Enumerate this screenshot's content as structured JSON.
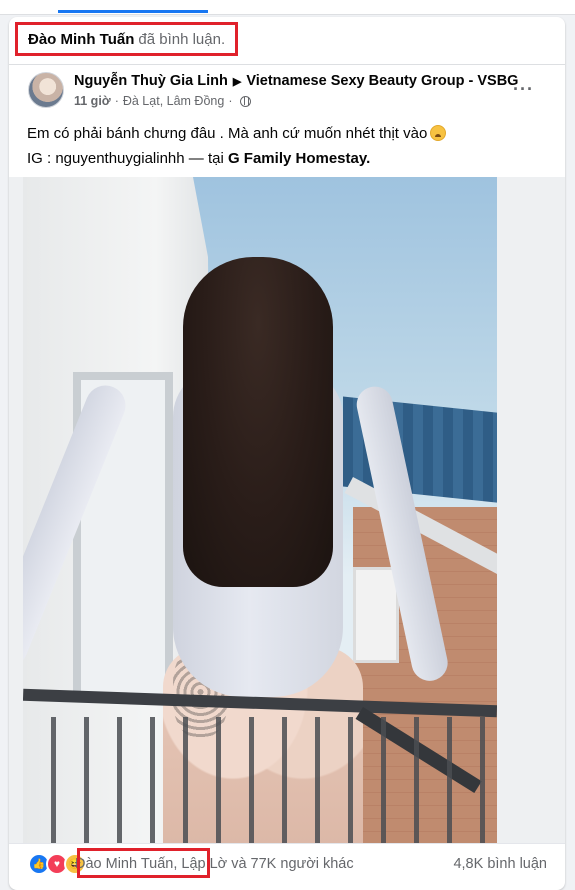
{
  "activity": {
    "actor": "Đào Minh Tuấn",
    "verb": "đã bình luận."
  },
  "post": {
    "author": "Nguyễn Thuỳ Gia Linh",
    "group": "Vietnamese Sexy Beauty Group - VSBG",
    "time": "11 giờ",
    "location": "Đà Lạt, Lâm Đồng",
    "privacy_icon": "globe-icon",
    "text_line1": "Em có phải bánh chưng đâu . Mà anh cứ muốn nhét thịt vào",
    "text_line2_prefix": "IG : nguyenthuygialinhh — tại",
    "text_line2_place": "G Family Homestay."
  },
  "footer": {
    "reactions": [
      "like-icon",
      "love-icon",
      "haha-icon"
    ],
    "reactors": "Đào Minh Tuấn, Lập Lờ và 77K người khác",
    "comments": "4,8K bình luận"
  },
  "colors": {
    "highlight_box": "#e0212b",
    "brand": "#1877f2",
    "secondary_text": "#65676b"
  }
}
